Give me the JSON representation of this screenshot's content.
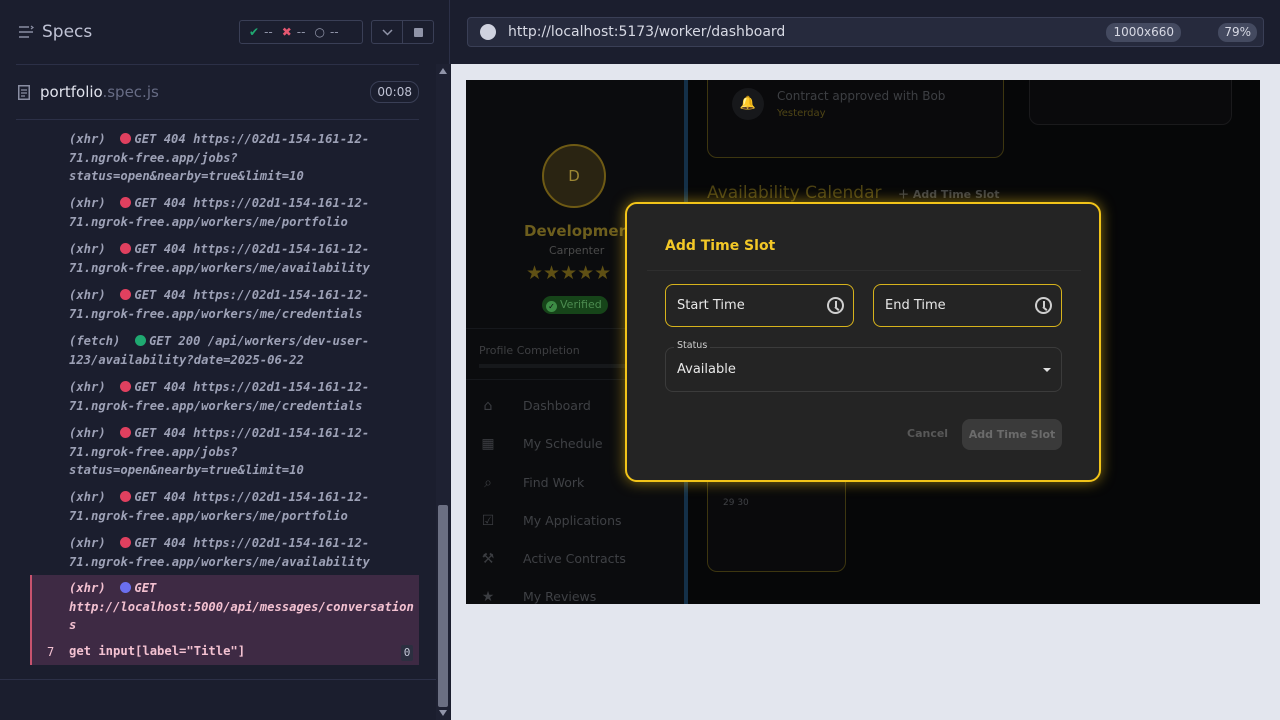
{
  "runner": {
    "specs_title": "Specs",
    "stats": {
      "passed": "--",
      "failed": "--",
      "pending": "--"
    },
    "file": {
      "name": "portfolio",
      "ext": ".spec.js",
      "duration": "00:08"
    },
    "log": [
      {
        "type": "(xhr)",
        "dot": "red",
        "lines": [
          "GET 404 https://02d1-154-161-12-",
          "71.ngrok-free.app/jobs?",
          "status=open&nearby=true&limit=10"
        ]
      },
      {
        "type": "(xhr)",
        "dot": "red",
        "lines": [
          "GET 404 https://02d1-154-161-12-",
          "71.ngrok-free.app/workers/me/portfolio"
        ]
      },
      {
        "type": "(xhr)",
        "dot": "red",
        "lines": [
          "GET 404 https://02d1-154-161-12-",
          "71.ngrok-free.app/workers/me/availability"
        ]
      },
      {
        "type": "(xhr)",
        "dot": "red",
        "lines": [
          "GET 404 https://02d1-154-161-12-",
          "71.ngrok-free.app/workers/me/credentials"
        ]
      },
      {
        "type": "(fetch)",
        "dot": "green",
        "lines": [
          "GET 200 /api/workers/dev-user-",
          "123/availability?date=2025-06-22"
        ]
      },
      {
        "type": "(xhr)",
        "dot": "red",
        "lines": [
          "GET 404 https://02d1-154-161-12-",
          "71.ngrok-free.app/workers/me/credentials"
        ]
      },
      {
        "type": "(xhr)",
        "dot": "red",
        "lines": [
          "GET 404 https://02d1-154-161-12-",
          "71.ngrok-free.app/jobs?",
          "status=open&nearby=true&limit=10"
        ]
      },
      {
        "type": "(xhr)",
        "dot": "red",
        "lines": [
          "GET 404 https://02d1-154-161-12-",
          "71.ngrok-free.app/workers/me/portfolio"
        ]
      },
      {
        "type": "(xhr)",
        "dot": "red",
        "lines": [
          "GET 404 https://02d1-154-161-12-",
          "71.ngrok-free.app/workers/me/availability"
        ]
      }
    ],
    "active": {
      "type": "(xhr)",
      "method": "GET",
      "lines": [
        "http://localhost:5000/api/messages/conversation",
        "s"
      ],
      "cmd_number": "7",
      "cmd_text": "get  input[label=\"Title\"]",
      "cmd_count": "0"
    }
  },
  "browser": {
    "url": "http://localhost:5173/worker/dashboard",
    "viewport": "1000x660",
    "zoom": "79%"
  },
  "app": {
    "avatar_letter": "D",
    "name": "Development",
    "role": "Carpenter",
    "stars": "★★★★★",
    "verified": "Verified",
    "profile_completion": "Profile Completion",
    "nav": [
      {
        "label": "Dashboard",
        "icon": "home-icon",
        "glyph": "⌂"
      },
      {
        "label": "My Schedule",
        "icon": "calendar-icon",
        "glyph": "▦"
      },
      {
        "label": "Find Work",
        "icon": "search-doc-icon",
        "glyph": "⌕"
      },
      {
        "label": "My Applications",
        "icon": "clipboard-check-icon",
        "glyph": "☑"
      },
      {
        "label": "Active Contracts",
        "icon": "gavel-icon",
        "glyph": "⚒"
      },
      {
        "label": "My Reviews",
        "icon": "star-icon",
        "glyph": "★"
      }
    ],
    "notification": {
      "text": "Contract approved with Bob",
      "time": "Yesterday"
    },
    "calendar_title": "Availability Calendar",
    "calendar_add": "Add Time Slot",
    "calendar_days": "29  30"
  },
  "dialog": {
    "title": "Add Time Slot",
    "start_label": "Start Time",
    "end_label": "End Time",
    "status_label": "Status",
    "status_value": "Available",
    "cancel": "Cancel",
    "submit": "Add Time Slot"
  },
  "colors": {
    "accent": "#f2c419",
    "runner_bg": "#1b1e2e",
    "error_dot": "#e0405f",
    "success_dot": "#1fa971"
  }
}
